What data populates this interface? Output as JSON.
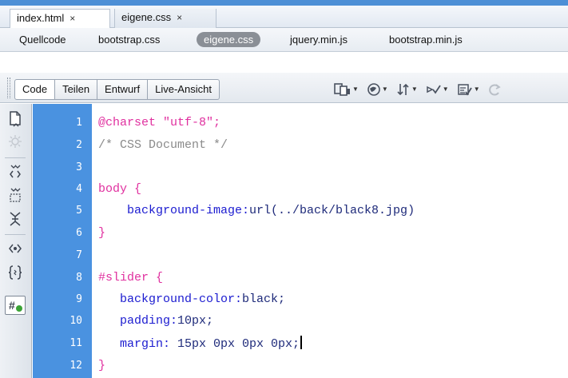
{
  "tabs": [
    {
      "label": "index.html",
      "close": "×"
    },
    {
      "label": "eigene.css",
      "close": "×"
    }
  ],
  "related_files": [
    {
      "label": "Quellcode"
    },
    {
      "label": "bootstrap.css"
    },
    {
      "label": "eigene.css",
      "selected": true
    },
    {
      "label": "jquery.min.js"
    },
    {
      "label": "bootstrap.min.js"
    }
  ],
  "view_buttons": [
    {
      "label": "Code",
      "active": true
    },
    {
      "label": "Teilen"
    },
    {
      "label": "Entwurf"
    },
    {
      "label": "Live-Ansicht"
    }
  ],
  "toolbar_icons": [
    "multiscreen-icon",
    "browser-preview-icon",
    "file-transfer-icon",
    "validate-icon",
    "visual-aids-icon",
    "refresh-icon"
  ],
  "left_toolbar_icons": [
    "open-documents-icon",
    "toggle-highlight-icon",
    "collapse-tag-icon",
    "collapse-selection-icon",
    "expand-all-icon",
    "wrap-tag-icon",
    "apply-comment-icon",
    "format-source-icon"
  ],
  "code": {
    "line_numbers": [
      "1",
      "2",
      "3",
      "4",
      "5",
      "6",
      "7",
      "8",
      "9",
      "10",
      "11",
      "12"
    ],
    "lines": [
      {
        "t1": "@charset ",
        "t2": "\"utf-8\";"
      },
      {
        "t1": "/* CSS Document */"
      },
      {
        "t1": ""
      },
      {
        "t1": "body {"
      },
      {
        "t1": "    background-image:",
        "t2": "url(../back/black8.jpg)"
      },
      {
        "t1": "}"
      },
      {
        "t1": ""
      },
      {
        "t1": "#slider {"
      },
      {
        "t1": "   background-color:",
        "t2": "black;"
      },
      {
        "t1": "   padding:",
        "t2": "10px;"
      },
      {
        "t1": "   margin: ",
        "t2": "15px 0px 0px 0px;"
      },
      {
        "t1": "}"
      }
    ]
  },
  "colors": {
    "gutter": "#4a92e0",
    "selector": "#e0309f",
    "comment": "#8a8a8a",
    "property": "#1b1bd0",
    "value": "#1e2a7a"
  }
}
